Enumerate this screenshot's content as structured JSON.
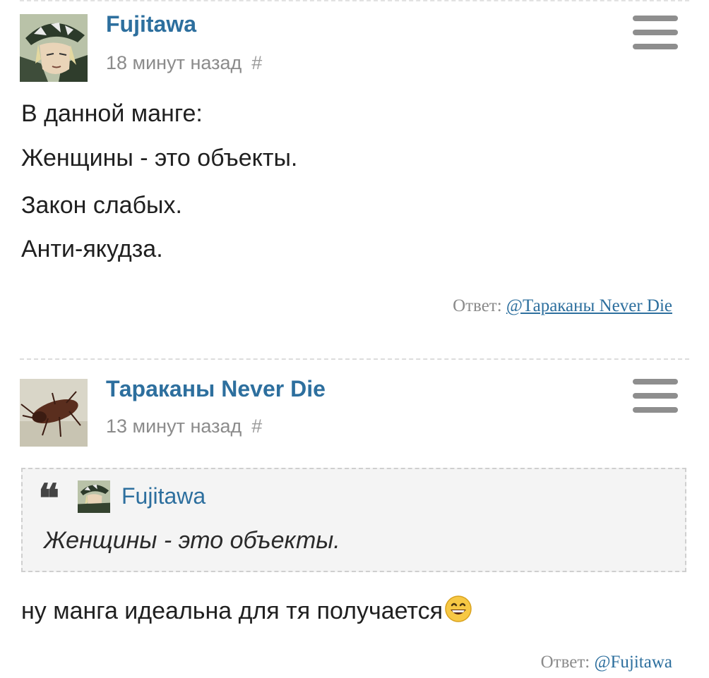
{
  "comments": [
    {
      "author": "Fujitawa",
      "time": "18 минут назад",
      "hash": "#",
      "lines": [
        "В данной манге:",
        "Женщины - это объекты.",
        "Закон слабых.",
        "Анти-якудза."
      ],
      "reply_label": "Ответ:",
      "reply_to": "@Тараканы Never Die"
    },
    {
      "author": "Тараканы Never Die",
      "time": "13 минут назад",
      "hash": "#",
      "quote": {
        "author": "Fujitawa",
        "text": "Женщины - это объекты."
      },
      "text": "ну манга идеальна для тя получается",
      "reply_label": "Ответ:",
      "reply_to": "@Fujitawa"
    }
  ],
  "icons": {
    "menu": "hamburger-icon",
    "quote": "quote-mark-icon",
    "emoji": "grinning-face-emoji"
  },
  "colors": {
    "link": "#2d6f9e",
    "muted": "#8b8b8b",
    "menu": "#8e8e8e"
  }
}
